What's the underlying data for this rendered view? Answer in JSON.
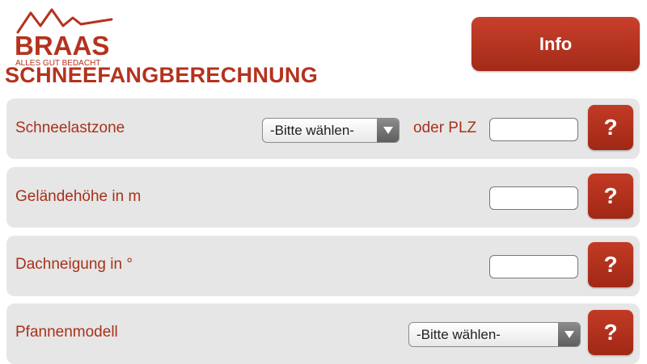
{
  "brand": {
    "name": "BRAAS",
    "tagline": "ALLES GUT BEDACHT",
    "accent": "#b5321e"
  },
  "page": {
    "title": "SCHNEEFANGBERECHNUNG"
  },
  "header": {
    "info_label": "Info"
  },
  "rows": [
    {
      "label": "Schneelastzone",
      "select_value": "-Bitte wählen-",
      "or_label": "oder PLZ",
      "help": "?"
    },
    {
      "label": "Geländehöhe in m",
      "help": "?"
    },
    {
      "label": "Dachneigung in °",
      "help": "?"
    },
    {
      "label": "Pfannenmodell",
      "select_value": "-Bitte wählen-",
      "help": "?"
    }
  ]
}
